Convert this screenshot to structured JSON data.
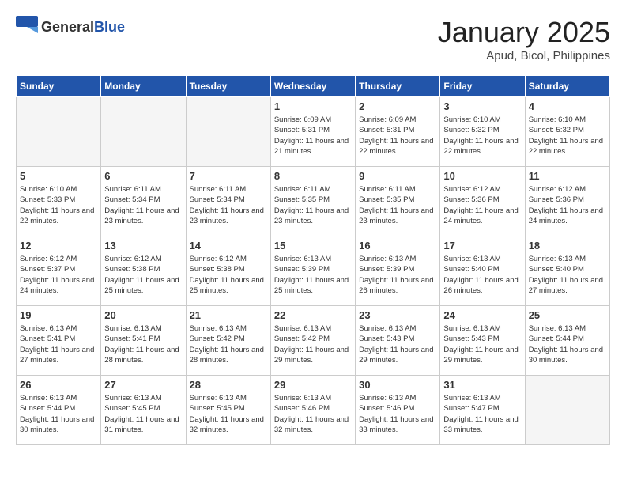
{
  "header": {
    "logo_general": "General",
    "logo_blue": "Blue",
    "title": "January 2025",
    "subtitle": "Apud, Bicol, Philippines"
  },
  "days_of_week": [
    "Sunday",
    "Monday",
    "Tuesday",
    "Wednesday",
    "Thursday",
    "Friday",
    "Saturday"
  ],
  "weeks": [
    [
      {
        "day": "",
        "info": ""
      },
      {
        "day": "",
        "info": ""
      },
      {
        "day": "",
        "info": ""
      },
      {
        "day": "1",
        "info": "Sunrise: 6:09 AM\nSunset: 5:31 PM\nDaylight: 11 hours\nand 21 minutes."
      },
      {
        "day": "2",
        "info": "Sunrise: 6:09 AM\nSunset: 5:31 PM\nDaylight: 11 hours\nand 22 minutes."
      },
      {
        "day": "3",
        "info": "Sunrise: 6:10 AM\nSunset: 5:32 PM\nDaylight: 11 hours\nand 22 minutes."
      },
      {
        "day": "4",
        "info": "Sunrise: 6:10 AM\nSunset: 5:32 PM\nDaylight: 11 hours\nand 22 minutes."
      }
    ],
    [
      {
        "day": "5",
        "info": "Sunrise: 6:10 AM\nSunset: 5:33 PM\nDaylight: 11 hours\nand 22 minutes."
      },
      {
        "day": "6",
        "info": "Sunrise: 6:11 AM\nSunset: 5:34 PM\nDaylight: 11 hours\nand 23 minutes."
      },
      {
        "day": "7",
        "info": "Sunrise: 6:11 AM\nSunset: 5:34 PM\nDaylight: 11 hours\nand 23 minutes."
      },
      {
        "day": "8",
        "info": "Sunrise: 6:11 AM\nSunset: 5:35 PM\nDaylight: 11 hours\nand 23 minutes."
      },
      {
        "day": "9",
        "info": "Sunrise: 6:11 AM\nSunset: 5:35 PM\nDaylight: 11 hours\nand 23 minutes."
      },
      {
        "day": "10",
        "info": "Sunrise: 6:12 AM\nSunset: 5:36 PM\nDaylight: 11 hours\nand 24 minutes."
      },
      {
        "day": "11",
        "info": "Sunrise: 6:12 AM\nSunset: 5:36 PM\nDaylight: 11 hours\nand 24 minutes."
      }
    ],
    [
      {
        "day": "12",
        "info": "Sunrise: 6:12 AM\nSunset: 5:37 PM\nDaylight: 11 hours\nand 24 minutes."
      },
      {
        "day": "13",
        "info": "Sunrise: 6:12 AM\nSunset: 5:38 PM\nDaylight: 11 hours\nand 25 minutes."
      },
      {
        "day": "14",
        "info": "Sunrise: 6:12 AM\nSunset: 5:38 PM\nDaylight: 11 hours\nand 25 minutes."
      },
      {
        "day": "15",
        "info": "Sunrise: 6:13 AM\nSunset: 5:39 PM\nDaylight: 11 hours\nand 25 minutes."
      },
      {
        "day": "16",
        "info": "Sunrise: 6:13 AM\nSunset: 5:39 PM\nDaylight: 11 hours\nand 26 minutes."
      },
      {
        "day": "17",
        "info": "Sunrise: 6:13 AM\nSunset: 5:40 PM\nDaylight: 11 hours\nand 26 minutes."
      },
      {
        "day": "18",
        "info": "Sunrise: 6:13 AM\nSunset: 5:40 PM\nDaylight: 11 hours\nand 27 minutes."
      }
    ],
    [
      {
        "day": "19",
        "info": "Sunrise: 6:13 AM\nSunset: 5:41 PM\nDaylight: 11 hours\nand 27 minutes."
      },
      {
        "day": "20",
        "info": "Sunrise: 6:13 AM\nSunset: 5:41 PM\nDaylight: 11 hours\nand 28 minutes."
      },
      {
        "day": "21",
        "info": "Sunrise: 6:13 AM\nSunset: 5:42 PM\nDaylight: 11 hours\nand 28 minutes."
      },
      {
        "day": "22",
        "info": "Sunrise: 6:13 AM\nSunset: 5:42 PM\nDaylight: 11 hours\nand 29 minutes."
      },
      {
        "day": "23",
        "info": "Sunrise: 6:13 AM\nSunset: 5:43 PM\nDaylight: 11 hours\nand 29 minutes."
      },
      {
        "day": "24",
        "info": "Sunrise: 6:13 AM\nSunset: 5:43 PM\nDaylight: 11 hours\nand 29 minutes."
      },
      {
        "day": "25",
        "info": "Sunrise: 6:13 AM\nSunset: 5:44 PM\nDaylight: 11 hours\nand 30 minutes."
      }
    ],
    [
      {
        "day": "26",
        "info": "Sunrise: 6:13 AM\nSunset: 5:44 PM\nDaylight: 11 hours\nand 30 minutes."
      },
      {
        "day": "27",
        "info": "Sunrise: 6:13 AM\nSunset: 5:45 PM\nDaylight: 11 hours\nand 31 minutes."
      },
      {
        "day": "28",
        "info": "Sunrise: 6:13 AM\nSunset: 5:45 PM\nDaylight: 11 hours\nand 32 minutes."
      },
      {
        "day": "29",
        "info": "Sunrise: 6:13 AM\nSunset: 5:46 PM\nDaylight: 11 hours\nand 32 minutes."
      },
      {
        "day": "30",
        "info": "Sunrise: 6:13 AM\nSunset: 5:46 PM\nDaylight: 11 hours\nand 33 minutes."
      },
      {
        "day": "31",
        "info": "Sunrise: 6:13 AM\nSunset: 5:47 PM\nDaylight: 11 hours\nand 33 minutes."
      },
      {
        "day": "",
        "info": ""
      }
    ]
  ]
}
